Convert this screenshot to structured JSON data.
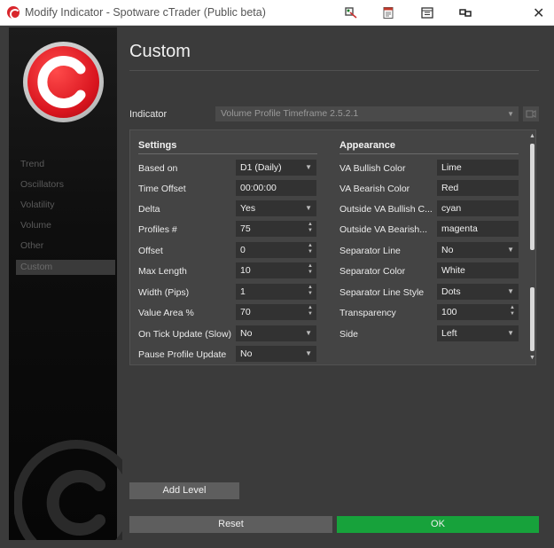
{
  "window": {
    "title": "Modify Indicator - Spotware cTrader (Public beta)",
    "toolbar_icons": [
      "pin-icon",
      "document-icon",
      "layout-icon",
      "link-icon"
    ],
    "close_symbol": "✕"
  },
  "sidebar": {
    "items": [
      {
        "label": "Trend",
        "active": false
      },
      {
        "label": "Oscillators",
        "active": false
      },
      {
        "label": "Volatility",
        "active": false
      },
      {
        "label": "Volume",
        "active": false
      },
      {
        "label": "Other",
        "active": false
      },
      {
        "label": "Custom",
        "active": true
      }
    ]
  },
  "main": {
    "heading": "Custom",
    "indicator_label": "Indicator",
    "indicator_value": "Volume Profile Timeframe 2.5.2.1"
  },
  "settings": {
    "title": "Settings",
    "rows": [
      {
        "label": "Based on",
        "value": "D1 (Daily)",
        "control": "dropdown"
      },
      {
        "label": "Time Offset",
        "value": "00:00:00",
        "control": "text"
      },
      {
        "label": "Delta",
        "value": "Yes",
        "control": "dropdown"
      },
      {
        "label": "Profiles #",
        "value": "75",
        "control": "spinner"
      },
      {
        "label": "Offset",
        "value": "0",
        "control": "spinner"
      },
      {
        "label": "Max Length",
        "value": "10",
        "control": "spinner"
      },
      {
        "label": "Width (Pips)",
        "value": "1",
        "control": "spinner"
      },
      {
        "label": "Value Area %",
        "value": "70",
        "control": "spinner"
      },
      {
        "label": "On Tick Update (Slow)",
        "value": "No",
        "control": "dropdown"
      },
      {
        "label": "Pause Profile Update",
        "value": "No",
        "control": "dropdown"
      }
    ]
  },
  "appearance": {
    "title": "Appearance",
    "rows": [
      {
        "label": "VA Bullish Color",
        "value": "Lime",
        "control": "text"
      },
      {
        "label": "VA Bearish Color",
        "value": "Red",
        "control": "text"
      },
      {
        "label": "Outside VA Bullish C...",
        "value": "cyan",
        "control": "text"
      },
      {
        "label": "Outside VA Bearish...",
        "value": "magenta",
        "control": "text"
      },
      {
        "label": "Separator Line",
        "value": "No",
        "control": "dropdown"
      },
      {
        "label": "Separator Color",
        "value": "White",
        "control": "text"
      },
      {
        "label": "Separator Line Style",
        "value": "Dots",
        "control": "dropdown"
      },
      {
        "label": "Transparency",
        "value": "100",
        "control": "spinner"
      },
      {
        "label": "Side",
        "value": "Left",
        "control": "dropdown"
      }
    ]
  },
  "buttons": {
    "add_level": "Add Level",
    "reset": "Reset",
    "ok": "OK"
  },
  "colors": {
    "accent_ok": "#17a23b",
    "brand_red": "#d9262c",
    "panel_bg": "#444444"
  }
}
